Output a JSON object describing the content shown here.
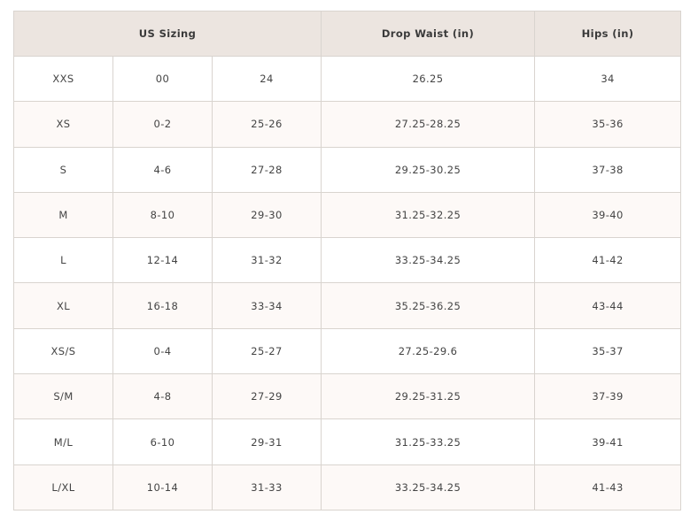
{
  "table": {
    "headers": {
      "us_sizing": "US Sizing",
      "drop_waist": "Drop Waist (in)",
      "hips": "Hips (in)"
    },
    "rows": [
      [
        "XXS",
        "00",
        "24",
        "26.25",
        "34"
      ],
      [
        "XS",
        "0-2",
        "25-26",
        "27.25-28.25",
        "35-36"
      ],
      [
        "S",
        "4-6",
        "27-28",
        "29.25-30.25",
        "37-38"
      ],
      [
        "M",
        "8-10",
        "29-30",
        "31.25-32.25",
        "39-40"
      ],
      [
        "L",
        "12-14",
        "31-32",
        "33.25-34.25",
        "41-42"
      ],
      [
        "XL",
        "16-18",
        "33-34",
        "35.25-36.25",
        "43-44"
      ],
      [
        "XS/S",
        "0-4",
        "25-27",
        "27.25-29.6",
        "35-37"
      ],
      [
        "S/M",
        "4-8",
        "27-29",
        "29.25-31.25",
        "37-39"
      ],
      [
        "M/L",
        "6-10",
        "29-31",
        "31.25-33.25",
        "39-41"
      ],
      [
        "L/XL",
        "10-14",
        "31-33",
        "33.25-34.25",
        "41-43"
      ]
    ]
  },
  "colors": {
    "header_bg": "#ece5e0",
    "alt_row_bg": "#fdf9f7",
    "border": "#d9d4cf",
    "text": "#3a3a3a"
  }
}
